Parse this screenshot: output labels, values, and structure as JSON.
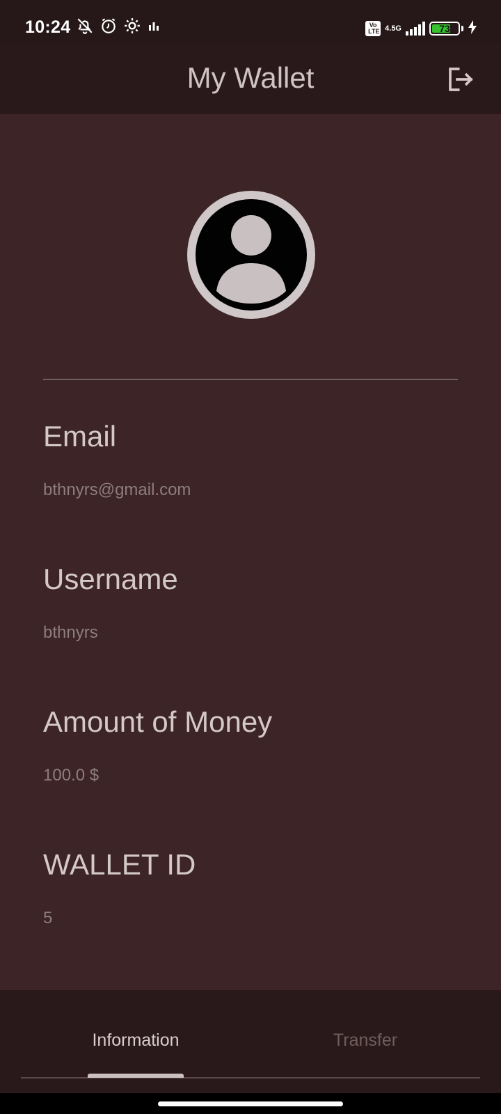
{
  "status_bar": {
    "time": "10:24",
    "icons": [
      "notifications-off-icon",
      "alarm-icon",
      "settings-icon",
      "data-usage-icon"
    ],
    "volte_top": "Vo",
    "volte_bottom": "LTE",
    "network": "4.5G",
    "battery_level": "73",
    "battery_fraction": 0.73,
    "charging": true
  },
  "app_bar": {
    "title": "My Wallet",
    "action_icon": "logout-icon"
  },
  "profile": {
    "avatar_icon": "account-circle-icon"
  },
  "fields": [
    {
      "label": "Email",
      "value": "bthnyrs@gmail.com"
    },
    {
      "label": "Username",
      "value": "bthnyrs"
    },
    {
      "label": "Amount of Money",
      "value": "100.0 $"
    },
    {
      "label": "WALLET ID",
      "value": "5"
    }
  ],
  "tabs": [
    {
      "label": "Information",
      "selected": true
    },
    {
      "label": "Transfer",
      "selected": false
    }
  ],
  "colors": {
    "background": "#3d2426",
    "app_bar": "#2a191a",
    "text_primary": "#d4c8c9",
    "text_secondary": "#8d7d7e",
    "battery": "#35c22e"
  }
}
